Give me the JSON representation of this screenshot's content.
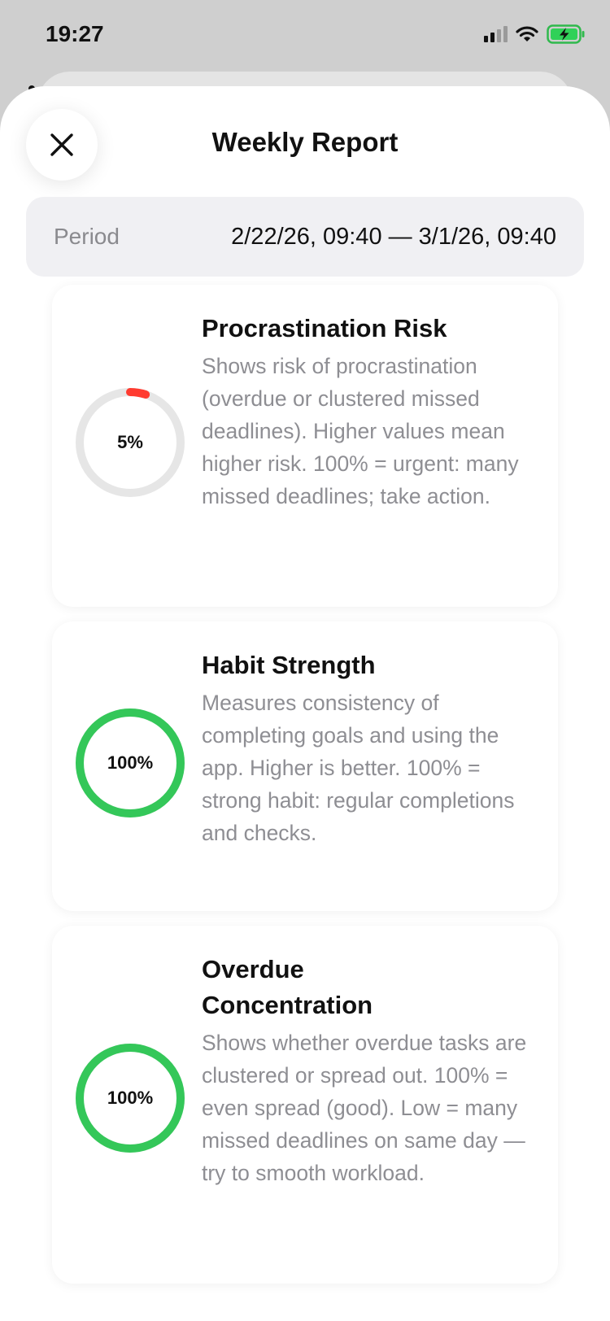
{
  "status_bar": {
    "time": "19:27"
  },
  "header": {
    "title": "Weekly Report"
  },
  "period": {
    "label": "Period",
    "value": "2/22/26, 09:40 — 3/1/26, 09:40"
  },
  "metrics": [
    {
      "title": "Procrastination Risk",
      "value_label": "5%",
      "value": 0.05,
      "color": "#ff3b30",
      "description": "Shows risk of procrastination (overdue or clustered missed deadlines). Higher values mean higher risk. 100% = urgent: many missed deadlines; take action."
    },
    {
      "title": "Habit Strength",
      "value_label": "100%",
      "value": 1.0,
      "color": "#34c759",
      "description": "Measures consistency of completing goals and using the app. Higher is better. 100% = strong habit: regular completions and checks."
    },
    {
      "title": "Overdue Concentration",
      "value_label": "100%",
      "value": 1.0,
      "color": "#34c759",
      "description": "Shows whether overdue tasks are clustered or spread out. 100% = even spread (good). Low = many missed deadlines on same day — try to smooth workload."
    }
  ],
  "colors": {
    "ring_track": "#e6e6e6"
  },
  "icons": {
    "close": "close-icon",
    "signal": "cellular-signal-icon",
    "wifi": "wifi-icon",
    "battery": "battery-charging-icon"
  }
}
